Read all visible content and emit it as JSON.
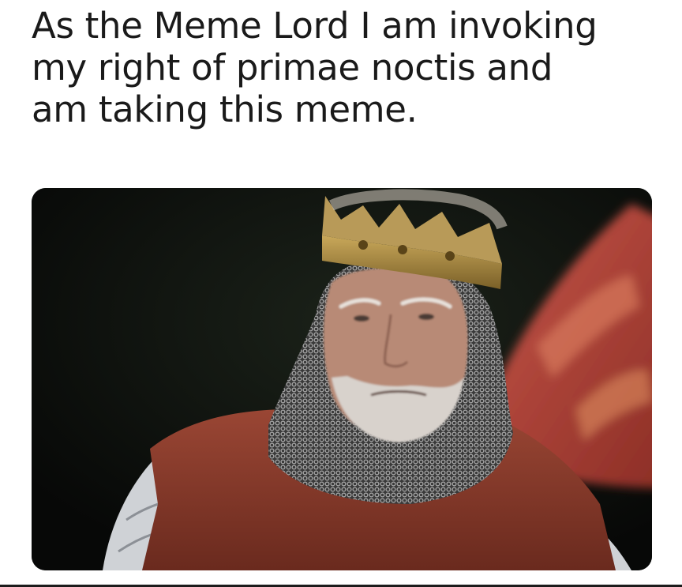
{
  "meme": {
    "caption": "As the Meme Lord I am invoking\nmy right of primae noctis and\nam taking this meme."
  },
  "image": {
    "subject": "king-in-crown-and-chainmail",
    "colors": {
      "background": "#0b0d0b",
      "crown": "#a88a3a",
      "tunic": "#8a3a2a",
      "banner": "#b8473a",
      "mail": "#7f7f7f",
      "skin": "#b88a76",
      "beard": "#d8d2cc"
    }
  }
}
